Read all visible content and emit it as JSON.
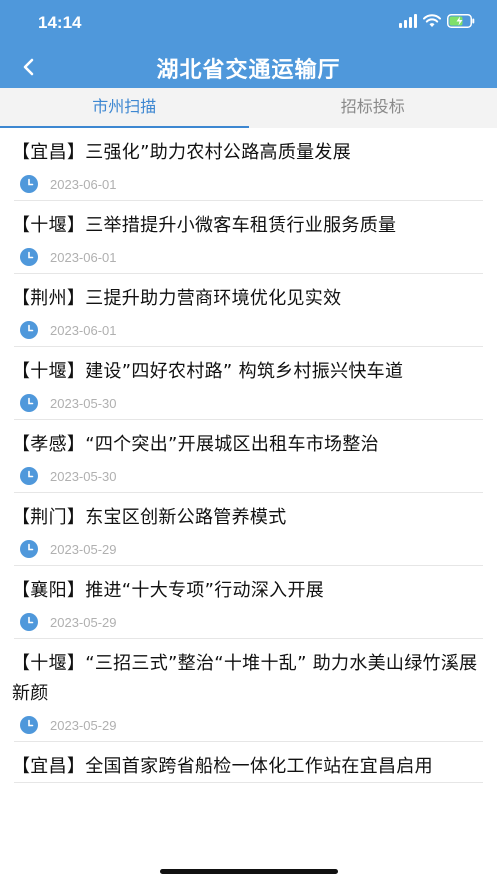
{
  "status": {
    "time": "14:14"
  },
  "header": {
    "title": "湖北省交通运输厅"
  },
  "tabs": [
    {
      "label": "市州扫描",
      "active": true
    },
    {
      "label": "招标投标",
      "active": false
    }
  ],
  "articles": [
    {
      "title": "【宜昌】三强化”助力农村公路高质量发展",
      "date": "2023-06-01"
    },
    {
      "title": "【十堰】三举措提升小微客车租赁行业服务质量",
      "date": "2023-06-01"
    },
    {
      "title": "【荆州】三提升助力营商环境优化见实效",
      "date": "2023-06-01"
    },
    {
      "title": "【十堰】建设”四好农村路” 构筑乡村振兴快车道",
      "date": "2023-05-30"
    },
    {
      "title": "【孝感】“四个突出”开展城区出租车市场整治",
      "date": "2023-05-30"
    },
    {
      "title": "【荆门】东宝区创新公路管养模式",
      "date": "2023-05-29"
    },
    {
      "title": "【襄阳】推进“十大专项”行动深入开展",
      "date": "2023-05-29"
    },
    {
      "title": "【十堰】“三招三式”整治“十堆十乱” 助力水美山绿竹溪展新颜",
      "date": "2023-05-29"
    },
    {
      "title": "【宜昌】全国首家跨省船检一体化工作站在宜昌启用",
      "date": ""
    }
  ],
  "colors": {
    "header": "#4f98db",
    "accent": "#3d87d1",
    "clock": "#4f98db"
  }
}
